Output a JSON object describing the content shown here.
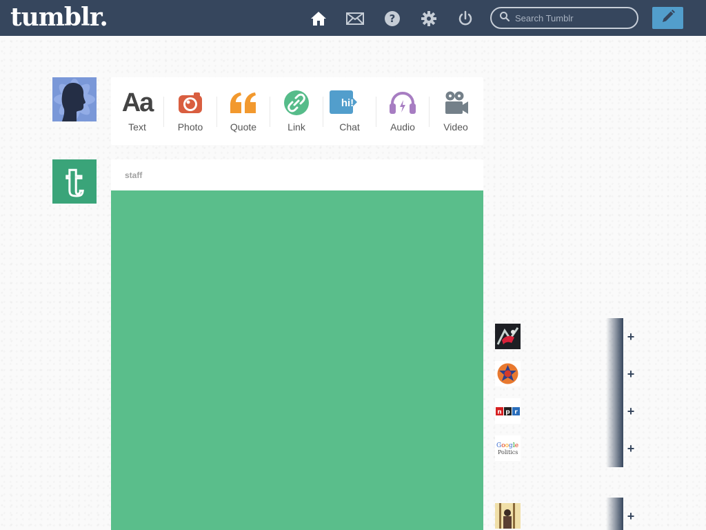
{
  "header": {
    "logo": "tumblr.",
    "search_placeholder": "Search Tumblr"
  },
  "post_types": [
    {
      "label": "Text",
      "icon": "text-icon",
      "glyph": "Aa",
      "color": "#444444"
    },
    {
      "label": "Photo",
      "icon": "camera-icon",
      "color": "#d95e40"
    },
    {
      "label": "Quote",
      "icon": "quote-icon",
      "glyph": "“",
      "color": "#f2992e"
    },
    {
      "label": "Link",
      "icon": "link-icon",
      "color": "#56bc8a"
    },
    {
      "label": "Chat",
      "icon": "chat-icon",
      "glyph": "hi!",
      "color": "#529ecc"
    },
    {
      "label": "Audio",
      "icon": "headphones-icon",
      "color": "#a77dc2"
    },
    {
      "label": "Video",
      "icon": "video-camera-icon",
      "color": "#748089"
    }
  ],
  "post": {
    "author": "staff",
    "media_color": "#5abe8b"
  },
  "sidebar": {
    "blog_title": "",
    "menu": [
      "",
      "",
      "",
      ""
    ],
    "blogs_head": "",
    "blog_actions": [
      "",
      ""
    ],
    "recommended_head": ""
  },
  "recommended": [
    {
      "name": "",
      "sub": ""
    },
    {
      "name": "",
      "sub": ""
    },
    {
      "name": "",
      "sub": ""
    },
    {
      "name": "",
      "sub": ""
    },
    {
      "name": "",
      "sub": ""
    }
  ],
  "npr_logo": "npr",
  "google_politics_logo": "Google Politics",
  "follow_symbol": "+",
  "colors": {
    "header": "#36465d",
    "compose": "#529ecc",
    "staff_avatar": "#3aa479"
  }
}
